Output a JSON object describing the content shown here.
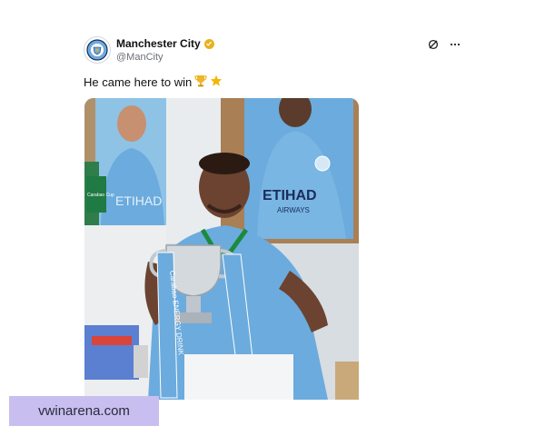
{
  "post": {
    "display_name": "Manchester City",
    "handle": "@ManCity",
    "verified": true,
    "text": "He came here to win",
    "emojis": [
      "trophy",
      "star"
    ],
    "icons": [
      "grok-icon",
      "more-options-icon"
    ]
  },
  "photo": {
    "banner_text_1": "ETIHAD",
    "banner_text_2": "AIRWAYS",
    "left_banner_text": "ETIHAD",
    "ribbon_text": "Carabao ENERGY DRINK",
    "board_text": "Carabao Cup"
  },
  "watermark": {
    "text": "vwinarena.com"
  },
  "colors": {
    "city_blue": "#6cabdd",
    "verified_gold": "#e8b21c",
    "watermark_bg": "#c8bff0"
  }
}
